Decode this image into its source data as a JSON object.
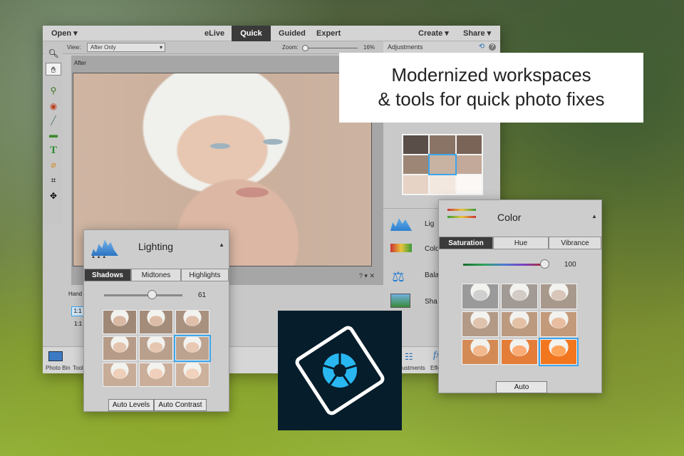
{
  "menubar": {
    "open": "Open",
    "elive": "eLive",
    "quick": "Quick",
    "guided": "Guided",
    "expert": "Expert",
    "create": "Create",
    "share": "Share"
  },
  "options": {
    "view_label": "View:",
    "view_value": "After Only",
    "zoom_label": "Zoom:",
    "zoom_value": "16%",
    "zoom_level": 0.05
  },
  "adjustments": {
    "title": "Adjustments"
  },
  "canvas": {
    "after_label": "After"
  },
  "sidebar_small": {
    "hand": "Hand",
    "one_to_one_a": "1:1",
    "one_to_one_b": "1:1"
  },
  "right_list": {
    "lighting": "Lig",
    "color": "Colo",
    "balance": "Bala",
    "sharpen": "Sha"
  },
  "bottom": {
    "photo_bin": "Photo Bin",
    "tool": "Tool",
    "adjustments": "djustments",
    "effects": "Effe"
  },
  "callout": {
    "line1": "Modernized workspaces",
    "line2": "& tools for quick photo fixes"
  },
  "lighting_panel": {
    "title": "Lighting",
    "tabs": [
      "Shadows",
      "Midtones",
      "Highlights"
    ],
    "selected_tab": "Shadows",
    "slider_value": "61",
    "slider_level": 0.61,
    "auto_levels": "Auto Levels",
    "auto_contrast": "Auto Contrast",
    "selected_thumb": 5
  },
  "color_panel": {
    "title": "Color",
    "tabs": [
      "Saturation",
      "Hue",
      "Vibrance"
    ],
    "selected_tab": "Saturation",
    "slider_value": "100",
    "slider_level": 1.0,
    "auto": "Auto",
    "selected_thumb": 8
  },
  "colors": {
    "accent": "#3aa6ee",
    "logo_bg": "#061d2b",
    "logo_icon": "#29b7f2"
  }
}
